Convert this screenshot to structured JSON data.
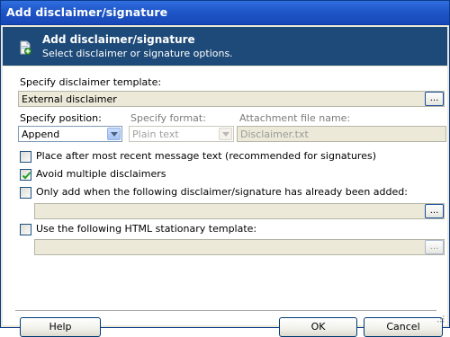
{
  "window": {
    "title": "Add disclaimer/signature"
  },
  "header": {
    "title": "Add disclaimer/signature",
    "subtitle": "Select disclaimer or signature options.",
    "icon": "add-document-icon"
  },
  "template": {
    "label": "Specify disclaimer template:",
    "value": "External disclaimer",
    "browse_label": "..."
  },
  "position": {
    "label": "Specify position:",
    "value": "Append"
  },
  "format": {
    "label": "Specify format:",
    "value": "Plain text"
  },
  "attachment": {
    "label": "Attachment file name:",
    "value": "Disclaimer.txt"
  },
  "options": {
    "place_after": {
      "label": "Place after most recent message text (recommended for signatures)",
      "checked": false
    },
    "avoid_multiple": {
      "label": "Avoid multiple disclaimers",
      "checked": true
    },
    "only_add": {
      "label": "Only add when the following disclaimer/signature has already been added:",
      "checked": false,
      "browse_label": "..."
    },
    "use_html": {
      "label": "Use the following HTML stationary template:",
      "checked": false,
      "browse_label": "..."
    }
  },
  "buttons": {
    "help": "Help",
    "ok": "OK",
    "cancel": "Cancel"
  }
}
